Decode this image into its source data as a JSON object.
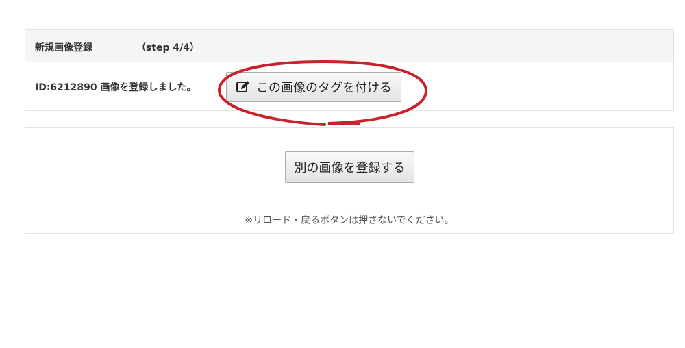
{
  "step_panel": {
    "title": "新規画像登録",
    "step": "（step 4/4）"
  },
  "result": {
    "message": "ID:6212890 画像を登録しました。",
    "tag_button_label": "この画像のタグを付ける",
    "tag_button_icon": "edit-icon"
  },
  "actions": {
    "register_another_label": "別の画像を登録する",
    "notice": "※リロード・戻るボタンは押さないでください。"
  },
  "colors": {
    "highlight": "#c8232c",
    "heading_bg": "#f5f5f5"
  }
}
